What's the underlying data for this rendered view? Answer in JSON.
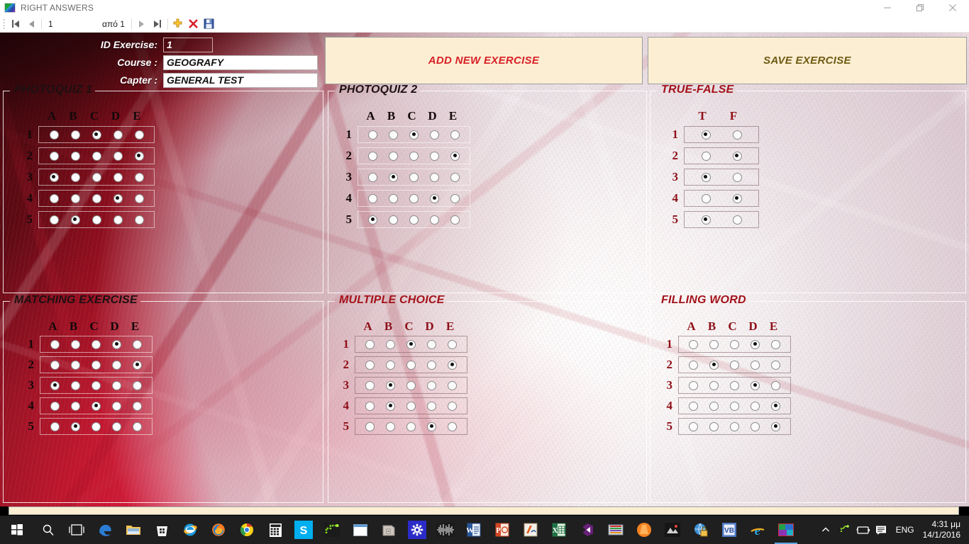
{
  "window": {
    "title": "RIGHT ANSWERS",
    "icon": "app-icon",
    "minimize_label": "Minimize",
    "maximize_label": "Restore",
    "close_label": "Close"
  },
  "navbar": {
    "first_label": "First record",
    "prev_label": "Previous record",
    "page_value": "1",
    "of_label": "από 1",
    "next_label": "Next record",
    "last_label": "Last record",
    "add_label": "Add new record",
    "delete_label": "Delete record",
    "save_label": "Save data"
  },
  "form": {
    "fields": [
      {
        "label": "ID Exercise:",
        "value": "1",
        "transparent": true
      },
      {
        "label": "Course :",
        "value": "GEOGRAFY",
        "transparent": false
      },
      {
        "label": "Capter :",
        "value": "GENERAL TEST",
        "transparent": false
      }
    ],
    "add_button": "ADD NEW EXERCISE",
    "save_button": "SAVE EXERCISE",
    "add_button_color": "#d81f26",
    "save_button_color": "#6f5a13",
    "button_bg": "#fbeed3"
  },
  "groups": [
    {
      "id": "photoquiz-1",
      "title": "PHOTOQUIZ 1",
      "title_tone": "light",
      "columns": [
        "A",
        "B",
        "C",
        "D",
        "E"
      ],
      "rows": [
        "1",
        "2",
        "3",
        "4",
        "5"
      ],
      "selected": [
        "C",
        "E",
        "A",
        "D",
        "B"
      ]
    },
    {
      "id": "photoquiz-2",
      "title": "PHOTOQUIZ 2",
      "title_tone": "light",
      "columns": [
        "A",
        "B",
        "C",
        "D",
        "E"
      ],
      "rows": [
        "1",
        "2",
        "3",
        "4",
        "5"
      ],
      "selected": [
        "C",
        "E",
        "B",
        "D",
        "A"
      ]
    },
    {
      "id": "true-false",
      "title": "TRUE-FALSE",
      "title_tone": "dark",
      "columns": [
        "T",
        "F"
      ],
      "rows": [
        "1",
        "2",
        "3",
        "4",
        "5"
      ],
      "selected": [
        "T",
        "F",
        "T",
        "F",
        "T"
      ]
    },
    {
      "id": "matching-exercise",
      "title": "MATCHING EXERCISE",
      "title_tone": "light",
      "columns": [
        "A",
        "B",
        "C",
        "D",
        "E"
      ],
      "rows": [
        "1",
        "2",
        "3",
        "4",
        "5"
      ],
      "selected": [
        "D",
        "E",
        "A",
        "C",
        "B"
      ]
    },
    {
      "id": "multiple-choice",
      "title": "MULTIPLE CHOICE",
      "title_tone": "dark",
      "columns": [
        "A",
        "B",
        "C",
        "D",
        "E"
      ],
      "rows": [
        "1",
        "2",
        "3",
        "4",
        "5"
      ],
      "selected": [
        "C",
        "E",
        "B",
        "B",
        "D"
      ]
    },
    {
      "id": "filling-word",
      "title": "FILLING WORD",
      "title_tone": "dark",
      "columns": [
        "A",
        "B",
        "C",
        "D",
        "E"
      ],
      "rows": [
        "1",
        "2",
        "3",
        "4",
        "5"
      ],
      "selected": [
        "D",
        "B",
        "D",
        "E",
        "E"
      ]
    }
  ],
  "taskbar": {
    "items": [
      {
        "name": "start-button",
        "icon": "windows-logo-icon"
      },
      {
        "name": "search-button",
        "icon": "search-icon"
      },
      {
        "name": "task-view-button",
        "icon": "task-view-icon"
      },
      {
        "name": "edge-button",
        "icon": "edge-icon"
      },
      {
        "name": "file-explorer-button",
        "icon": "folder-icon"
      },
      {
        "name": "microsoft-store-button",
        "icon": "store-icon"
      },
      {
        "name": "internet-explorer-button",
        "icon": "internet-explorer-icon"
      },
      {
        "name": "firefox-button",
        "icon": "firefox-icon"
      },
      {
        "name": "chrome-button",
        "icon": "chrome-icon"
      },
      {
        "name": "calculator-button",
        "icon": "calculator-icon"
      },
      {
        "name": "skype-button",
        "icon": "skype-icon"
      },
      {
        "name": "snake-app-button",
        "icon": "snake-icon"
      },
      {
        "name": "window-app-button",
        "icon": "window-icon"
      },
      {
        "name": "archive-app-button",
        "icon": "archive-icon"
      },
      {
        "name": "settings-button",
        "icon": "gear-icon"
      },
      {
        "name": "audio-editor-button",
        "icon": "waveform-icon"
      },
      {
        "name": "word-button",
        "icon": "word-icon"
      },
      {
        "name": "powerpoint-button",
        "icon": "powerpoint-icon"
      },
      {
        "name": "media-player-button",
        "icon": "media-icon"
      },
      {
        "name": "excel-button",
        "icon": "excel-icon"
      },
      {
        "name": "visual-studio-button",
        "icon": "visual-studio-icon"
      },
      {
        "name": "winrar-button",
        "icon": "winrar-icon"
      },
      {
        "name": "vlc-button",
        "icon": "vlc-icon"
      },
      {
        "name": "photo-app-button",
        "icon": "photo-icon"
      },
      {
        "name": "browser-secure-button",
        "icon": "globe-lock-icon"
      },
      {
        "name": "visual-basic-button",
        "icon": "visual-basic-icon"
      },
      {
        "name": "internet-explorer-2-button",
        "icon": "internet-explorer-icon"
      },
      {
        "name": "right-answers-app-button",
        "icon": "app-icon",
        "active": true
      }
    ],
    "tray": [
      {
        "name": "show-hidden-icons-button",
        "icon": "chevron-up-icon"
      },
      {
        "name": "antivirus-tray-icon",
        "icon": "shield-icon"
      },
      {
        "name": "battery-tray-icon",
        "icon": "battery-icon"
      },
      {
        "name": "action-center-button",
        "icon": "notification-icon"
      }
    ],
    "language": "ENG",
    "clock_time": "4:31 μμ",
    "clock_date": "14/1/2016"
  }
}
